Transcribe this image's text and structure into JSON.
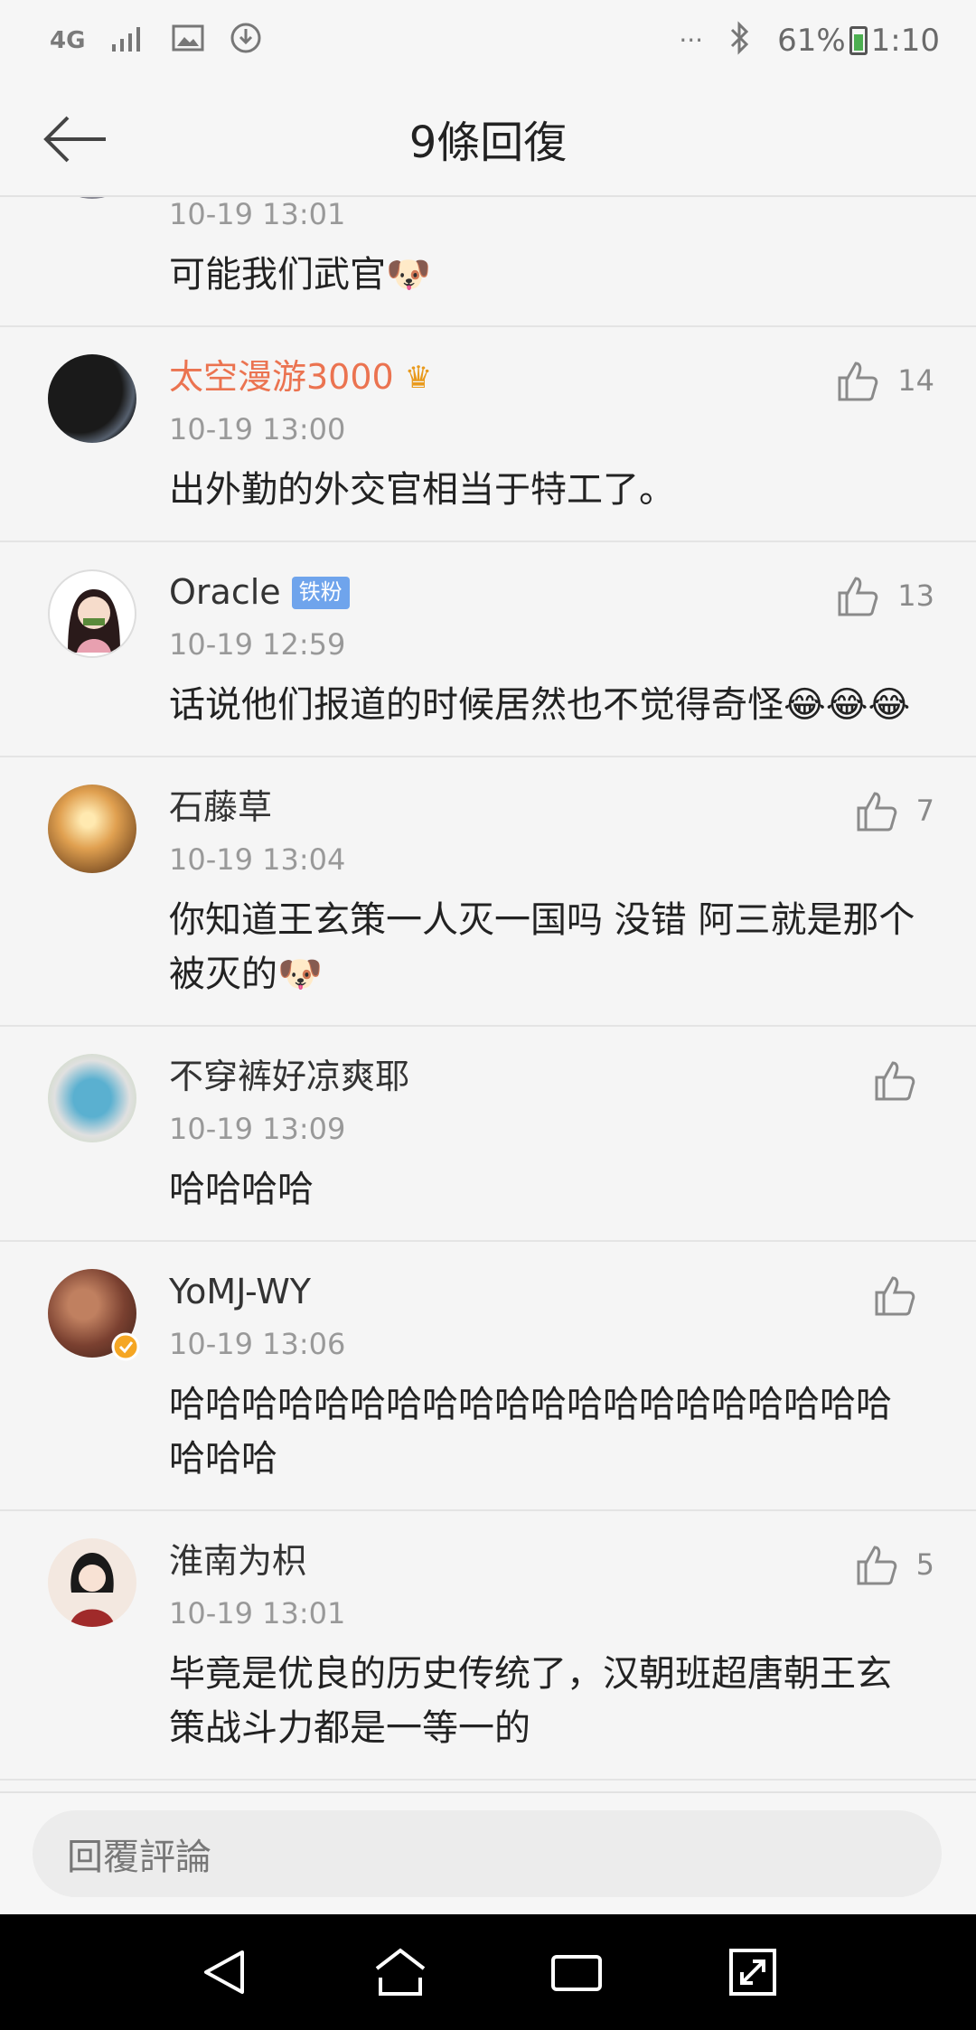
{
  "status_bar": {
    "network": "4G",
    "battery_percent": "61%",
    "time": "1:10",
    "dots": "···"
  },
  "header": {
    "title": "9條回復"
  },
  "comments": [
    {
      "name": "",
      "time": "10-19 13:01",
      "text": "可能我们武官",
      "likes": ""
    },
    {
      "name": "太空漫游3000",
      "time": "10-19 13:00",
      "text": "出外勤的外交官相当于特工了。",
      "likes": "14"
    },
    {
      "name": "Oracle",
      "badge": "铁粉",
      "time": "10-19 12:59",
      "text": "话说他们报道的时候居然也不觉得奇怪",
      "likes": "13"
    },
    {
      "name": "石藤草",
      "time": "10-19 13:04",
      "text": "你知道王玄策一人灭一国吗 没错 阿三就是那个被灭的",
      "likes": "7"
    },
    {
      "name": "不穿裤好凉爽耶",
      "time": "10-19 13:09",
      "text": "哈哈哈哈",
      "likes": ""
    },
    {
      "name": "YoMJ-WY",
      "time": "10-19 13:06",
      "text": "哈哈哈哈哈哈哈哈哈哈哈哈哈哈哈哈哈哈哈哈哈哈哈",
      "likes": ""
    },
    {
      "name": "淮南为枳",
      "time": "10-19 13:01",
      "text": "毕竟是优良的历史传统了，汉朝班超唐朝王玄策战斗力都是一等一的",
      "likes": "5"
    }
  ],
  "reply": {
    "placeholder": "回覆評論"
  },
  "colors": {
    "accent_orange": "#eb7350",
    "badge_blue": "#6fa4ec"
  }
}
